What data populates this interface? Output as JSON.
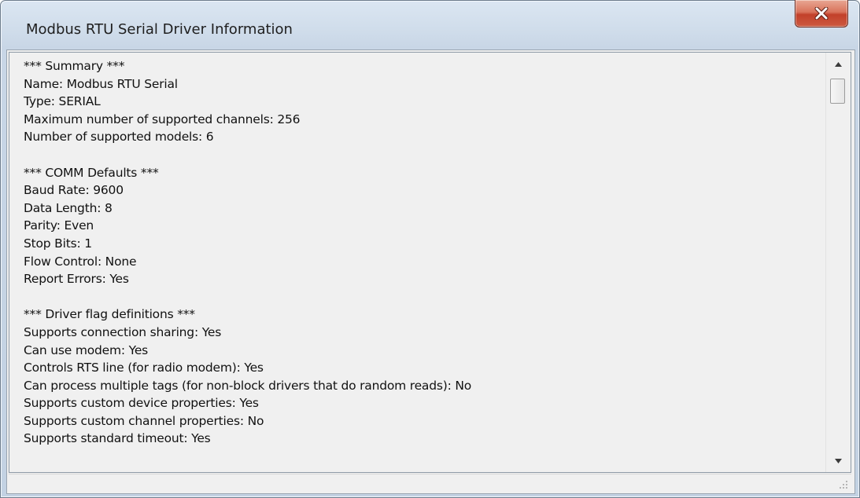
{
  "window": {
    "title": "Modbus RTU Serial Driver Information"
  },
  "titlebar": {
    "close_icon": "close-icon"
  },
  "content": {
    "lines": [
      "*** Summary ***",
      "Name: Modbus RTU Serial",
      "Type: SERIAL",
      "Maximum number of supported channels: 256",
      "Number of supported models: 6",
      "",
      "*** COMM Defaults ***",
      "Baud Rate: 9600",
      "Data Length: 8",
      "Parity: Even",
      "Stop Bits: 1",
      "Flow Control: None",
      "Report Errors: Yes",
      "",
      "*** Driver flag definitions ***",
      "Supports connection sharing: Yes",
      "Can use modem: Yes",
      "Controls RTS line (for radio modem): Yes",
      "Can process multiple tags (for non-block drivers that do random reads): No",
      "Supports custom device properties: Yes",
      "Supports custom channel properties: No",
      "Supports standard timeout: Yes"
    ]
  },
  "scrollbar": {
    "up_icon": "scroll-up-arrow-icon",
    "down_icon": "scroll-down-arrow-icon",
    "position": 0.0
  },
  "statusbar": {
    "grip_icon": "resize-grip-icon"
  }
}
